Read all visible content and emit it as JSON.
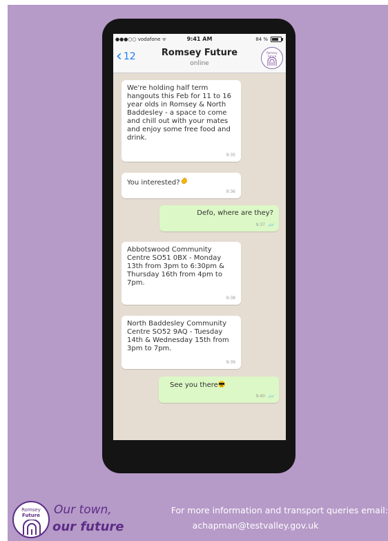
{
  "status_bar": {
    "carrier": "●●●○○ vodafone ᯤ",
    "time": "9:41 AM",
    "battery": "84 %"
  },
  "nav": {
    "back_count": "12",
    "title": "Romsey Future",
    "subtitle": "online",
    "avatar_line1": "Romsey",
    "avatar_line2": "Future"
  },
  "messages": [
    {
      "direction": "in",
      "text": "We're holding half term hangouts this Feb for 11 to 16 year olds in Romsey & North Baddesley - a space to come and chill out with your mates and enjoy some free food and drink.",
      "time": "9:35"
    },
    {
      "direction": "in",
      "text": "You interested?",
      "time": "9:36",
      "emoji": "waving-hand"
    },
    {
      "direction": "out",
      "text": "Defo, where are they?",
      "time": "9:37"
    },
    {
      "direction": "in",
      "text": "Abbotswood Community Centre SO51 0BX - Monday 13th from 3pm to 6:30pm & Thursday 16th from 4pm to 7pm.",
      "time": "9:38"
    },
    {
      "direction": "in",
      "text": "North Baddesley Community Centre SO52 9AQ - Tuesday 14th & Wednesday 15th from 3pm to 7pm.",
      "time": "9:39"
    },
    {
      "direction": "out",
      "text": "See you there",
      "time": "9:40",
      "emoji": "sunglasses-face"
    }
  ],
  "footer": {
    "logo_line1": "Romsey",
    "logo_line2": "Future",
    "tagline_line1": "Our town,",
    "tagline_line2": "our future",
    "info_line1": "For more information and transport queries email:",
    "info_line2": "achapman@testvalley.gov.uk"
  },
  "colors": {
    "poster_bg": "#b69ac8",
    "brand_purple": "#5c2d87",
    "incoming_bubble": "#ffffff",
    "outgoing_bubble": "#dcf8c6",
    "ios_blue": "#1a7cf5"
  }
}
